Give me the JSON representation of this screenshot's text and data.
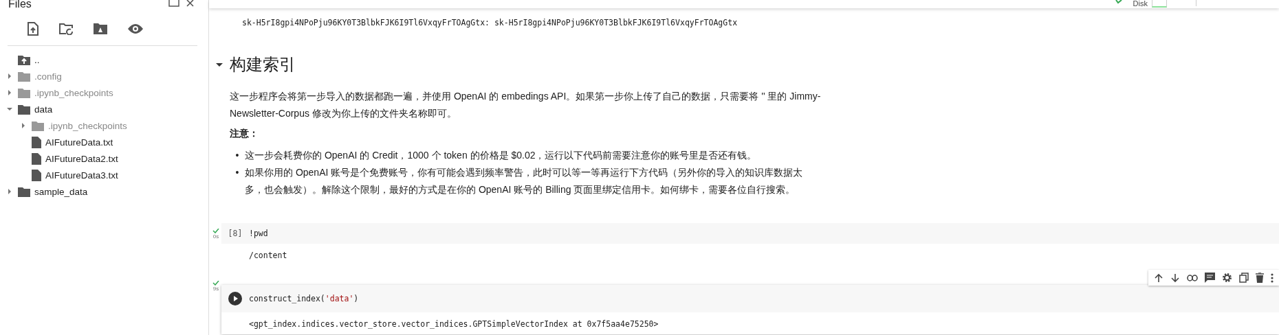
{
  "sidebar": {
    "title": "Files",
    "tree": [
      {
        "name": "..",
        "kind": "up"
      },
      {
        "name": ".config",
        "kind": "folder",
        "hidden": true,
        "expanded": false
      },
      {
        "name": ".ipynb_checkpoints",
        "kind": "folder",
        "hidden": true,
        "expanded": false
      },
      {
        "name": "data",
        "kind": "folder",
        "hidden": false,
        "expanded": true,
        "children": [
          {
            "name": ".ipynb_checkpoints",
            "kind": "folder",
            "hidden": true,
            "expanded": false
          },
          {
            "name": "AIFutureData.txt",
            "kind": "file"
          },
          {
            "name": "AIFutureData2.txt",
            "kind": "file"
          },
          {
            "name": "AIFutureData3.txt",
            "kind": "file"
          }
        ]
      },
      {
        "name": "sample_data",
        "kind": "folder",
        "hidden": false,
        "expanded": false
      }
    ]
  },
  "top_bar": {
    "disk_label": "Disk"
  },
  "previous_output": "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: 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",
  "section": {
    "heading": "构建索引",
    "expanded": true,
    "paragraph": "这一步程序会将第一步导入的数据都跑一遍，并使用 OpenAI 的 embedings API。如果第一步你上传了自己的数据，只需要将 '' 里的 Jimmy-Newsletter-Corpus 修改为你上传的文件夹名称即可。",
    "note_label": "注意：",
    "bullets": [
      {
        "marker": "•",
        "text": "这一步会耗费你的 OpenAI 的 Credit，1000 个 token 的价格是 $0.02，运行以下代码前需要注意你的账号里是否还有钱。"
      },
      {
        "marker": "•",
        "text": "如果你用的 OpenAI 账号是个免费账号，你有可能会遇到频率警告，此时可以等一等再运行下方代码（另外你的导入的知识库数据太多，也会触发）。解除这个限制，最好的方式是在你的 OpenAI 账号的 Billing 页面里绑定信用卡。如何绑卡，需要各位自行搜索。"
      }
    ]
  },
  "cells": [
    {
      "focused": false,
      "execution_count": "[8]",
      "time": "0s",
      "code": [
        {
          "text": "!pwd",
          "kind": "plain"
        }
      ],
      "output": "/content"
    },
    {
      "focused": true,
      "time": "9s",
      "code": [
        {
          "text": "construct_index(",
          "kind": "plain"
        },
        {
          "text": "'data'",
          "kind": "string"
        },
        {
          "text": ")",
          "kind": "plain"
        }
      ],
      "output": "<gpt_index.indices.vector_store.vector_indices.GPTSimpleVectorIndex at 0x7f5aa4e75250>"
    }
  ]
}
